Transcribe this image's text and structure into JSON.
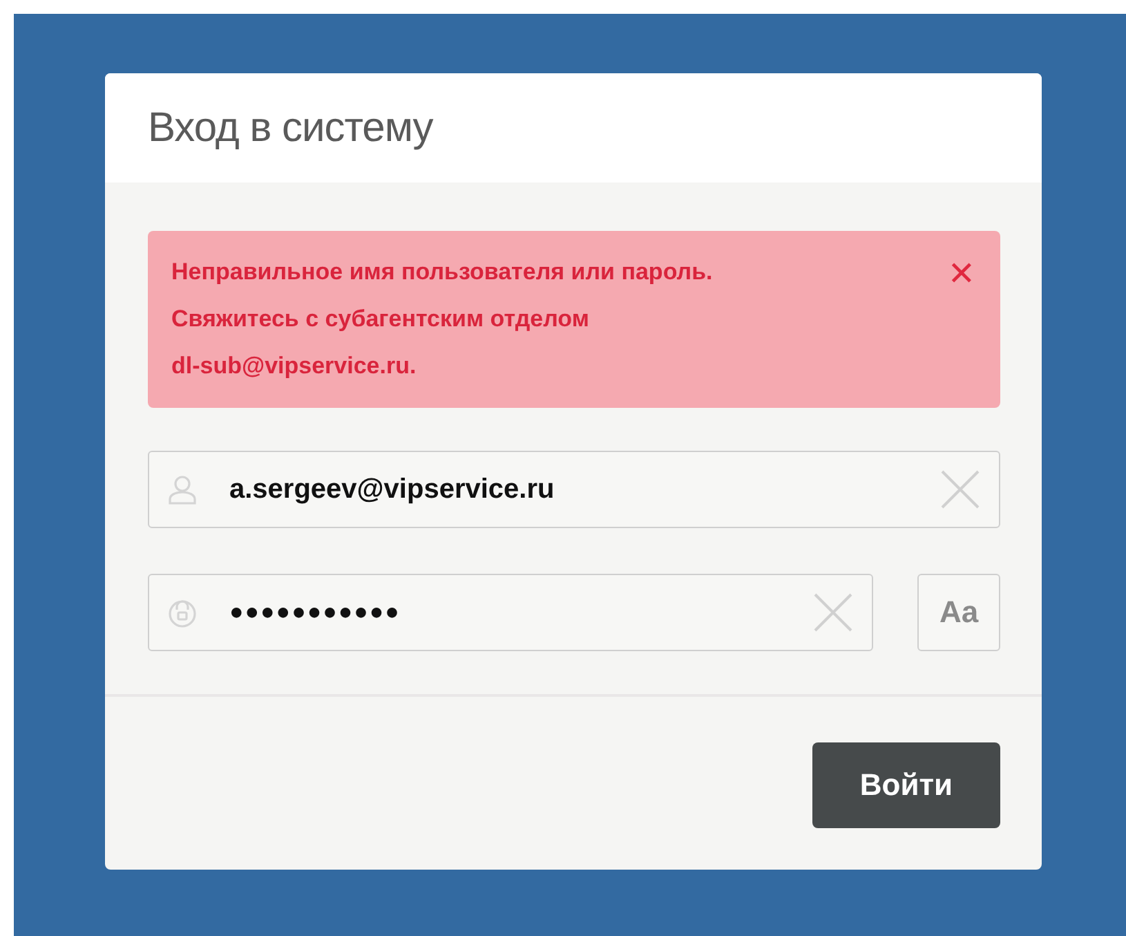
{
  "dialog": {
    "title": "Вход в систему"
  },
  "alert": {
    "lines": [
      "Неправильное имя пользователя или пароль.",
      "Свяжитесь с субагентским отделом",
      "dl-sub@vipservice.ru."
    ],
    "dismiss": "✕"
  },
  "username": {
    "value": "a.sergeev@vipservice.ru"
  },
  "password": {
    "value": "●●●●●●●●●●●",
    "toggle": "Aa"
  },
  "submit": "Войти"
}
